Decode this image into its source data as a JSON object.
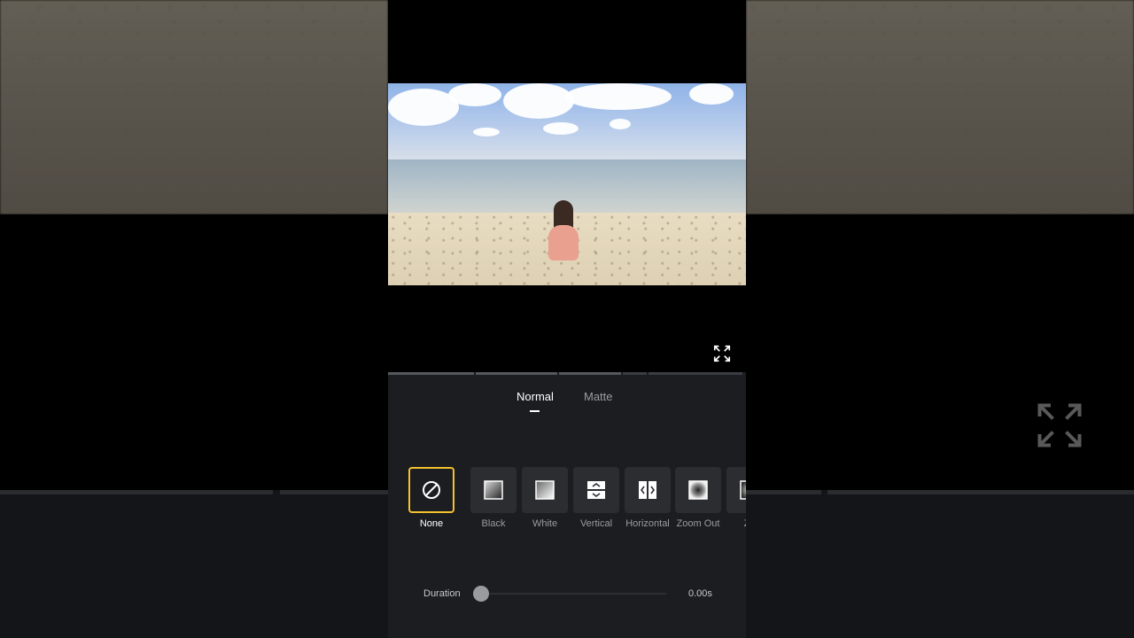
{
  "tabs": [
    {
      "label": "Normal",
      "active": true
    },
    {
      "label": "Matte",
      "active": false
    }
  ],
  "effects": [
    {
      "label": "None",
      "icon": "none-icon",
      "selected": true
    },
    {
      "label": "Black",
      "icon": "black-fade-icon",
      "selected": false
    },
    {
      "label": "White",
      "icon": "white-fade-icon",
      "selected": false
    },
    {
      "label": "Vertical",
      "icon": "vertical-split-icon",
      "selected": false
    },
    {
      "label": "Horizontal",
      "icon": "horizontal-split-icon",
      "selected": false
    },
    {
      "label": "Zoom Out",
      "icon": "zoom-out-icon",
      "selected": false
    },
    {
      "label": "Zo",
      "icon": "zoom-in-icon",
      "selected": false
    }
  ],
  "duration": {
    "label": "Duration",
    "value": "0.00s",
    "fraction": 0.0
  },
  "colors": {
    "accent": "#f2c230",
    "panel": "#1b1d20",
    "tile": "#2b2d31"
  }
}
